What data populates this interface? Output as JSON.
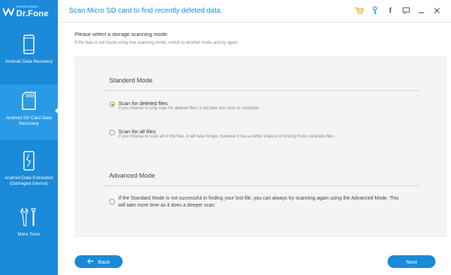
{
  "app": {
    "brand": "wondershare",
    "name": "Dr.Fone"
  },
  "header": {
    "title": "Scan Micro SD card to find recently deleted data."
  },
  "sidebar": {
    "items": [
      {
        "label": "Android Data Recovery",
        "icon": "phone-icon",
        "active": false
      },
      {
        "label": "Android SD Card Data Recovery",
        "icon": "sd-card-icon",
        "active": true
      },
      {
        "label": "Android Data Extraction (Damaged Device)",
        "icon": "broken-phone-icon",
        "active": false
      },
      {
        "label": "More Tools",
        "icon": "tools-icon",
        "active": false
      }
    ]
  },
  "toolbar_icons": [
    "cart-icon",
    "key-icon",
    "facebook-icon",
    "feedback-icon",
    "minimize-icon",
    "close-icon"
  ],
  "main": {
    "prompt": "Please select a storage scanning mode:",
    "hint": "If the data is not found using one scanning mode, switch to another mode and try again.",
    "standard": {
      "title": "Standerd Mode",
      "options": [
        {
          "title": "Scan for deleted files",
          "desc": "If you choose to only scan for deleted files, it will take less time to complete.",
          "checked": true
        },
        {
          "title": "Scan for all files",
          "desc": "If you choose to scan all of the files, it will take longer, however it has a better chance of finding more complete files.",
          "checked": false
        }
      ]
    },
    "advanced": {
      "title": "Advanced Mode",
      "option": {
        "text": "If the Standard Mode is not successful in finding your lost file, you can always try scanning again using the Advanced Mode. This will take more time as it does a deeper scan.",
        "checked": false
      }
    }
  },
  "footer": {
    "back_label": "Back",
    "next_label": "Next"
  },
  "colors": {
    "accent": "#1a8ad9",
    "selected_radio": "#6aad3c",
    "cart_key": "#f39c12"
  }
}
